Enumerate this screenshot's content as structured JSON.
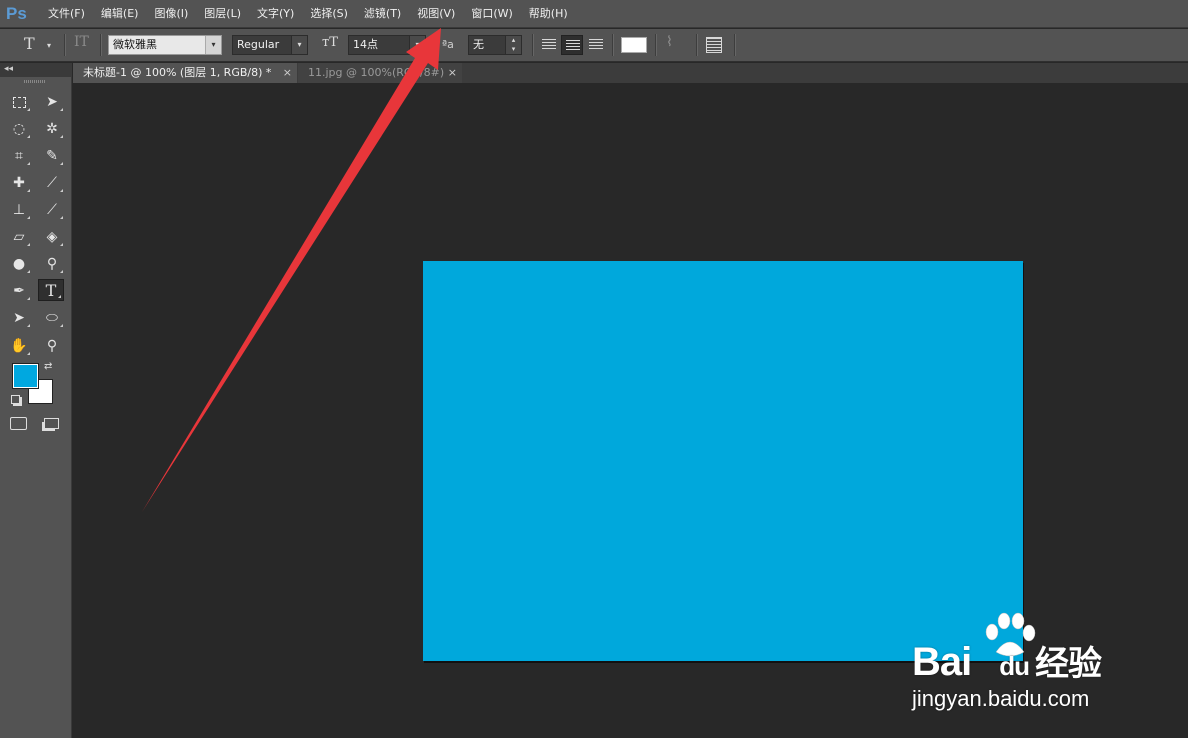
{
  "app": {
    "logo": "Ps"
  },
  "menu": [
    "文件(F)",
    "编辑(E)",
    "图像(I)",
    "图层(L)",
    "文字(Y)",
    "选择(S)",
    "滤镜(T)",
    "视图(V)",
    "窗口(W)",
    "帮助(H)"
  ],
  "options_bar": {
    "tool_icon": "text-tool-icon",
    "font_family": "微软雅黑",
    "font_style": "Regular",
    "font_size": "14点",
    "antialias_label": "ªa",
    "antialias": "无",
    "text_color": "#ffffff"
  },
  "tabs": [
    {
      "label": "未标题-1 @ 100% (图层 1, RGB/8) *",
      "active": true
    },
    {
      "label": "11.jpg @ 100%(RGB/8#)",
      "active": false
    }
  ],
  "toolbox": {
    "collapse_label": "◂◂",
    "foreground_color": "#00a8e0",
    "background_color": "#ffffff"
  },
  "canvas": {
    "fill_color": "#00a8dc"
  },
  "annotation": {
    "arrow_color": "#e8363a"
  },
  "watermark": {
    "logo_text": "Bai",
    "logo_suffix": "du",
    "brand_cn": "经验",
    "url": "jingyan.baidu.com"
  }
}
